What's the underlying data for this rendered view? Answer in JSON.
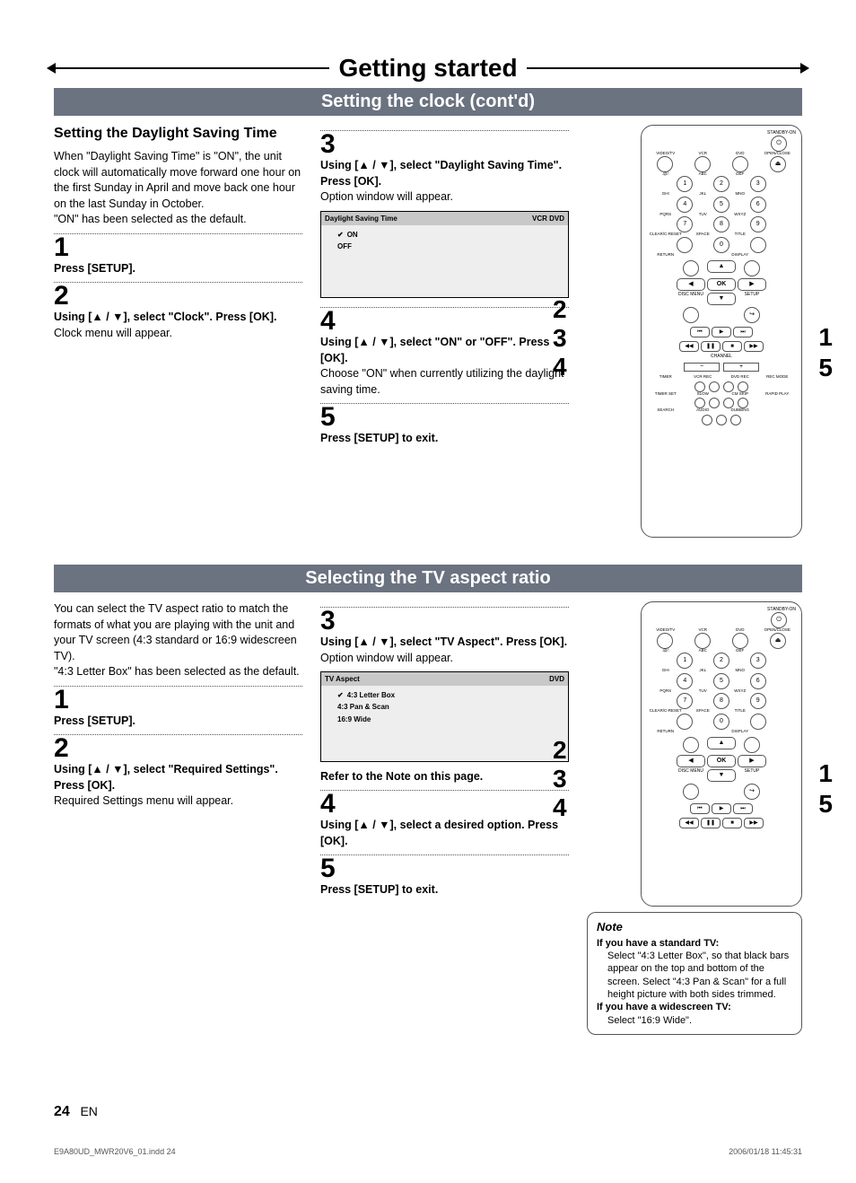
{
  "chapter_title": "Getting started",
  "section1": {
    "band": "Setting the clock (cont'd)",
    "left": {
      "heading": "Setting the Daylight Saving Time",
      "para": "When \"Daylight Saving Time\" is \"ON\", the unit clock will automatically move forward one hour on the first Sunday in April and move back one hour on the last Sunday in October.\n\"ON\" has been selected as the default.",
      "step1_num": "1",
      "step1_b": "Press [SETUP].",
      "step2_num": "2",
      "step2_b": "Using [▲ / ▼], select \"Clock\". Press [OK].",
      "step2_t": "Clock menu will appear."
    },
    "mid": {
      "step3_num": "3",
      "step3_b": "Using [▲ / ▼], select \"Daylight Saving Time\". Press [OK].",
      "step3_t": "Option window will appear.",
      "opt_title": "Daylight Saving Time",
      "opt_tags": "VCR  DVD",
      "opt1": "ON",
      "opt2": "OFF",
      "step4_num": "4",
      "step4_b": "Using [▲ / ▼], select \"ON\" or \"OFF\". Press [OK].",
      "step4_t": "Choose \"ON\" when currently utilizing the daylight saving time.",
      "step5_num": "5",
      "step5_b": "Press [SETUP] to exit."
    },
    "callouts_left": "2\n3\n4",
    "callouts_right": "1\n5"
  },
  "section2": {
    "band": "Selecting the TV aspect ratio",
    "left": {
      "para": "You can select the TV aspect ratio to match the formats of what you are playing with the unit and your TV screen (4:3 standard or 16:9 widescreen TV).\n\"4:3 Letter Box\" has been selected as the default.",
      "step1_num": "1",
      "step1_b": "Press [SETUP].",
      "step2_num": "2",
      "step2_b": "Using [▲ / ▼], select \"Required Settings\". Press [OK].",
      "step2_t": "Required Settings menu will appear."
    },
    "mid": {
      "step3_num": "3",
      "step3_b": "Using [▲ / ▼], select \"TV Aspect\". Press [OK].",
      "step3_t": "Option window will appear.",
      "opt_title": "TV Aspect",
      "opt_tags": "DVD",
      "opt1": "4:3 Letter Box",
      "opt2": "4:3 Pan & Scan",
      "opt3": "16:9 Wide",
      "refer": "Refer to the Note on this page.",
      "step4_num": "4",
      "step4_b": "Using [▲ / ▼], select a desired option. Press [OK].",
      "step5_num": "5",
      "step5_b": "Press [SETUP] to exit."
    },
    "callouts_left": "2\n3\n4",
    "callouts_right": "1\n5",
    "note": {
      "head": "Note",
      "l1b": "If you have a standard TV:",
      "l1": "Select \"4:3 Letter Box\", so that black bars appear on the top and bottom of the screen. Select \"4:3 Pan & Scan\" for a full height picture with both sides trimmed.",
      "l2b": "If you have a widescreen TV:",
      "l2": "Select \"16:9 Wide\"."
    }
  },
  "remote": {
    "top": "STANDBY-ON",
    "row1": [
      "VIDEO/TV",
      "VCR",
      "DVD",
      "OPEN/CLOSE"
    ],
    "row1sym": [
      "",
      "",
      "",
      "⏏"
    ],
    "row2lbl": [
      ".@/:",
      "ABC",
      "DEF",
      ""
    ],
    "row2": [
      "1",
      "2",
      "3"
    ],
    "row3lbl": [
      "GHI",
      "JKL",
      "MNO",
      ""
    ],
    "row3": [
      "4",
      "5",
      "6"
    ],
    "row4lbl": [
      "PQRS",
      "TUV",
      "WXYZ",
      ""
    ],
    "row4": [
      "7",
      "8",
      "9"
    ],
    "row5lbl": [
      "CLEAR/C-RESET",
      "SPACE",
      "TITLE",
      ""
    ],
    "row5": [
      "",
      "0",
      ""
    ],
    "row6lbl": [
      "RETURN",
      "",
      "DISPLAY",
      ""
    ],
    "ok": "OK",
    "discmenu": "DISC MENU",
    "setup": "SETUP",
    "channel": "CHANNEL",
    "row_timer_lbl": [
      "TIMER",
      "VCR REC",
      "DVD REC",
      "REC MODE"
    ],
    "row_timer2_lbl": [
      "TIMER SET",
      "SLOW",
      "CM SKIP",
      "RAPID PLAY"
    ],
    "row_bottom_lbl": [
      "SEARCH",
      "AUDIO",
      "DUBBING",
      ""
    ]
  },
  "page_number": "24",
  "page_lang": "EN",
  "footer_left": "E9A80UD_MWR20V6_01.indd   24",
  "footer_right": "2006/01/18   11:45:31"
}
